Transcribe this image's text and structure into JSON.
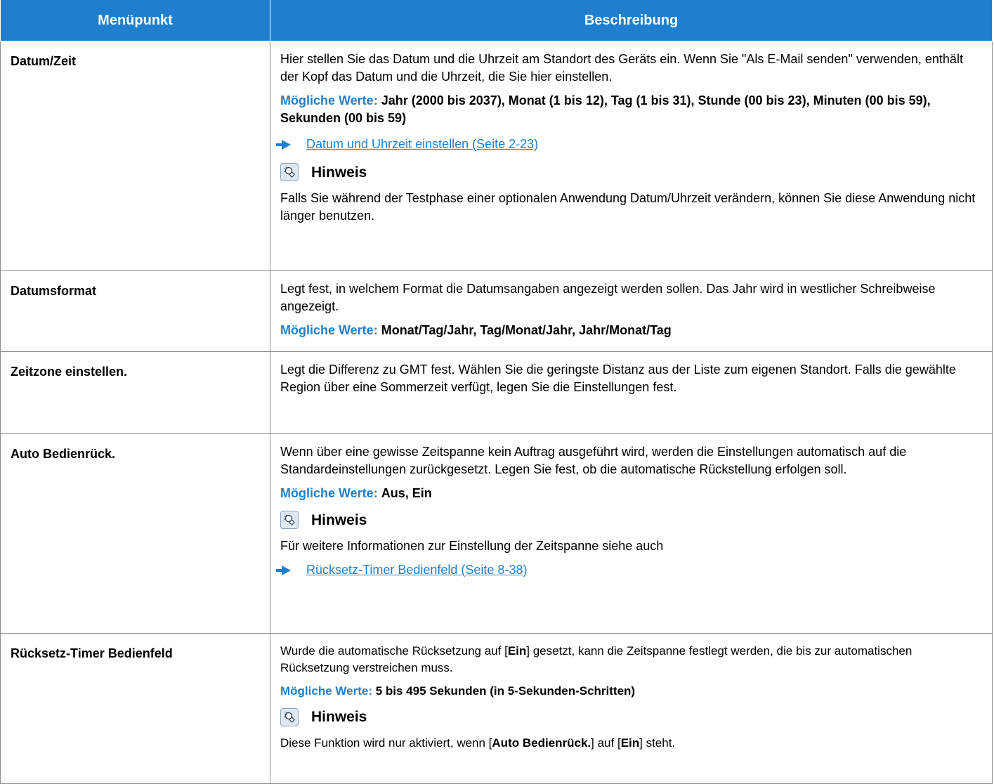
{
  "header": {
    "col1": "Menüpunkt",
    "col2": "Beschreibung"
  },
  "rows": [
    {
      "item": "Datum/Zeit",
      "desc": "Hier stellen Sie das Datum und die Uhrzeit am Standort des Geräts ein. Wenn Sie \"Als E-Mail senden\" verwenden, enthält der Kopf das Datum und die Uhrzeit, die Sie hier einstellen.",
      "pv_label": "Mögliche Werte:",
      "pv_value": "Jahr (2000 bis 2037), Monat (1 bis 12), Tag (1 bis 31), Stunde (00 bis 23), Minuten (00 bis 59), Sekunden (00 bis 59)",
      "link": "Datum und Uhrzeit einstellen (Seite 2-23)",
      "note_title": "Hinweis",
      "note_text": "Falls Sie während der Testphase einer optionalen Anwendung Datum/Uhrzeit verändern, können Sie diese Anwendung nicht länger benutzen."
    },
    {
      "item": "Datumsformat",
      "desc": "Legt fest, in welchem Format die Datumsangaben angezeigt werden sollen. Das Jahr wird in westlicher Schreibweise angezeigt.",
      "pv_label": "Mögliche Werte:",
      "pv_value": "Monat/Tag/Jahr, Tag/Monat/Jahr, Jahr/Monat/Tag"
    },
    {
      "item": "Zeitzone einstellen.",
      "desc": "Legt die Differenz zu GMT fest. Wählen Sie die geringste Distanz aus der Liste zum eigenen Standort. Falls die gewählte Region über eine Sommerzeit verfügt, legen Sie die Einstellungen fest."
    },
    {
      "item": "Auto Bedienrück.",
      "desc": "Wenn über eine gewisse Zeitspanne kein Auftrag ausgeführt wird, werden die Einstellungen automatisch auf die Standardeinstellungen zurückgesetzt. Legen Sie fest, ob die automatische Rückstellung erfolgen soll.",
      "pv_label": "Mögliche Werte:",
      "pv_value": "Aus, Ein",
      "note_title": "Hinweis",
      "note_text": "Für weitere Informationen zur Einstellung der Zeitspanne siehe auch",
      "link": "Rücksetz-Timer Bedienfeld (Seite 8-38)"
    },
    {
      "item": "Rücksetz-Timer Bedienfeld",
      "desc_a": "Wurde die automatische Rücksetzung auf [",
      "desc_b": "Ein",
      "desc_c": "] gesetzt, kann die Zeitspanne festlegt werden, die bis zur automatischen Rücksetzung verstreichen muss.",
      "pv_label": "Mögliche Werte:",
      "pv_value": "5 bis 495 Sekunden (in 5-Sekunden-Schritten)",
      "note_title": "Hinweis",
      "note_a": "Diese Funktion wird nur aktiviert, wenn [",
      "note_b": "Auto Bedienrück.",
      "note_c": "] auf [",
      "note_d": "Ein",
      "note_e": "] steht."
    }
  ],
  "icons": {
    "link_arrow": "arrow-right-icon",
    "note": "lightbulb-icon"
  },
  "colors": {
    "accent": "#1f7fce"
  }
}
